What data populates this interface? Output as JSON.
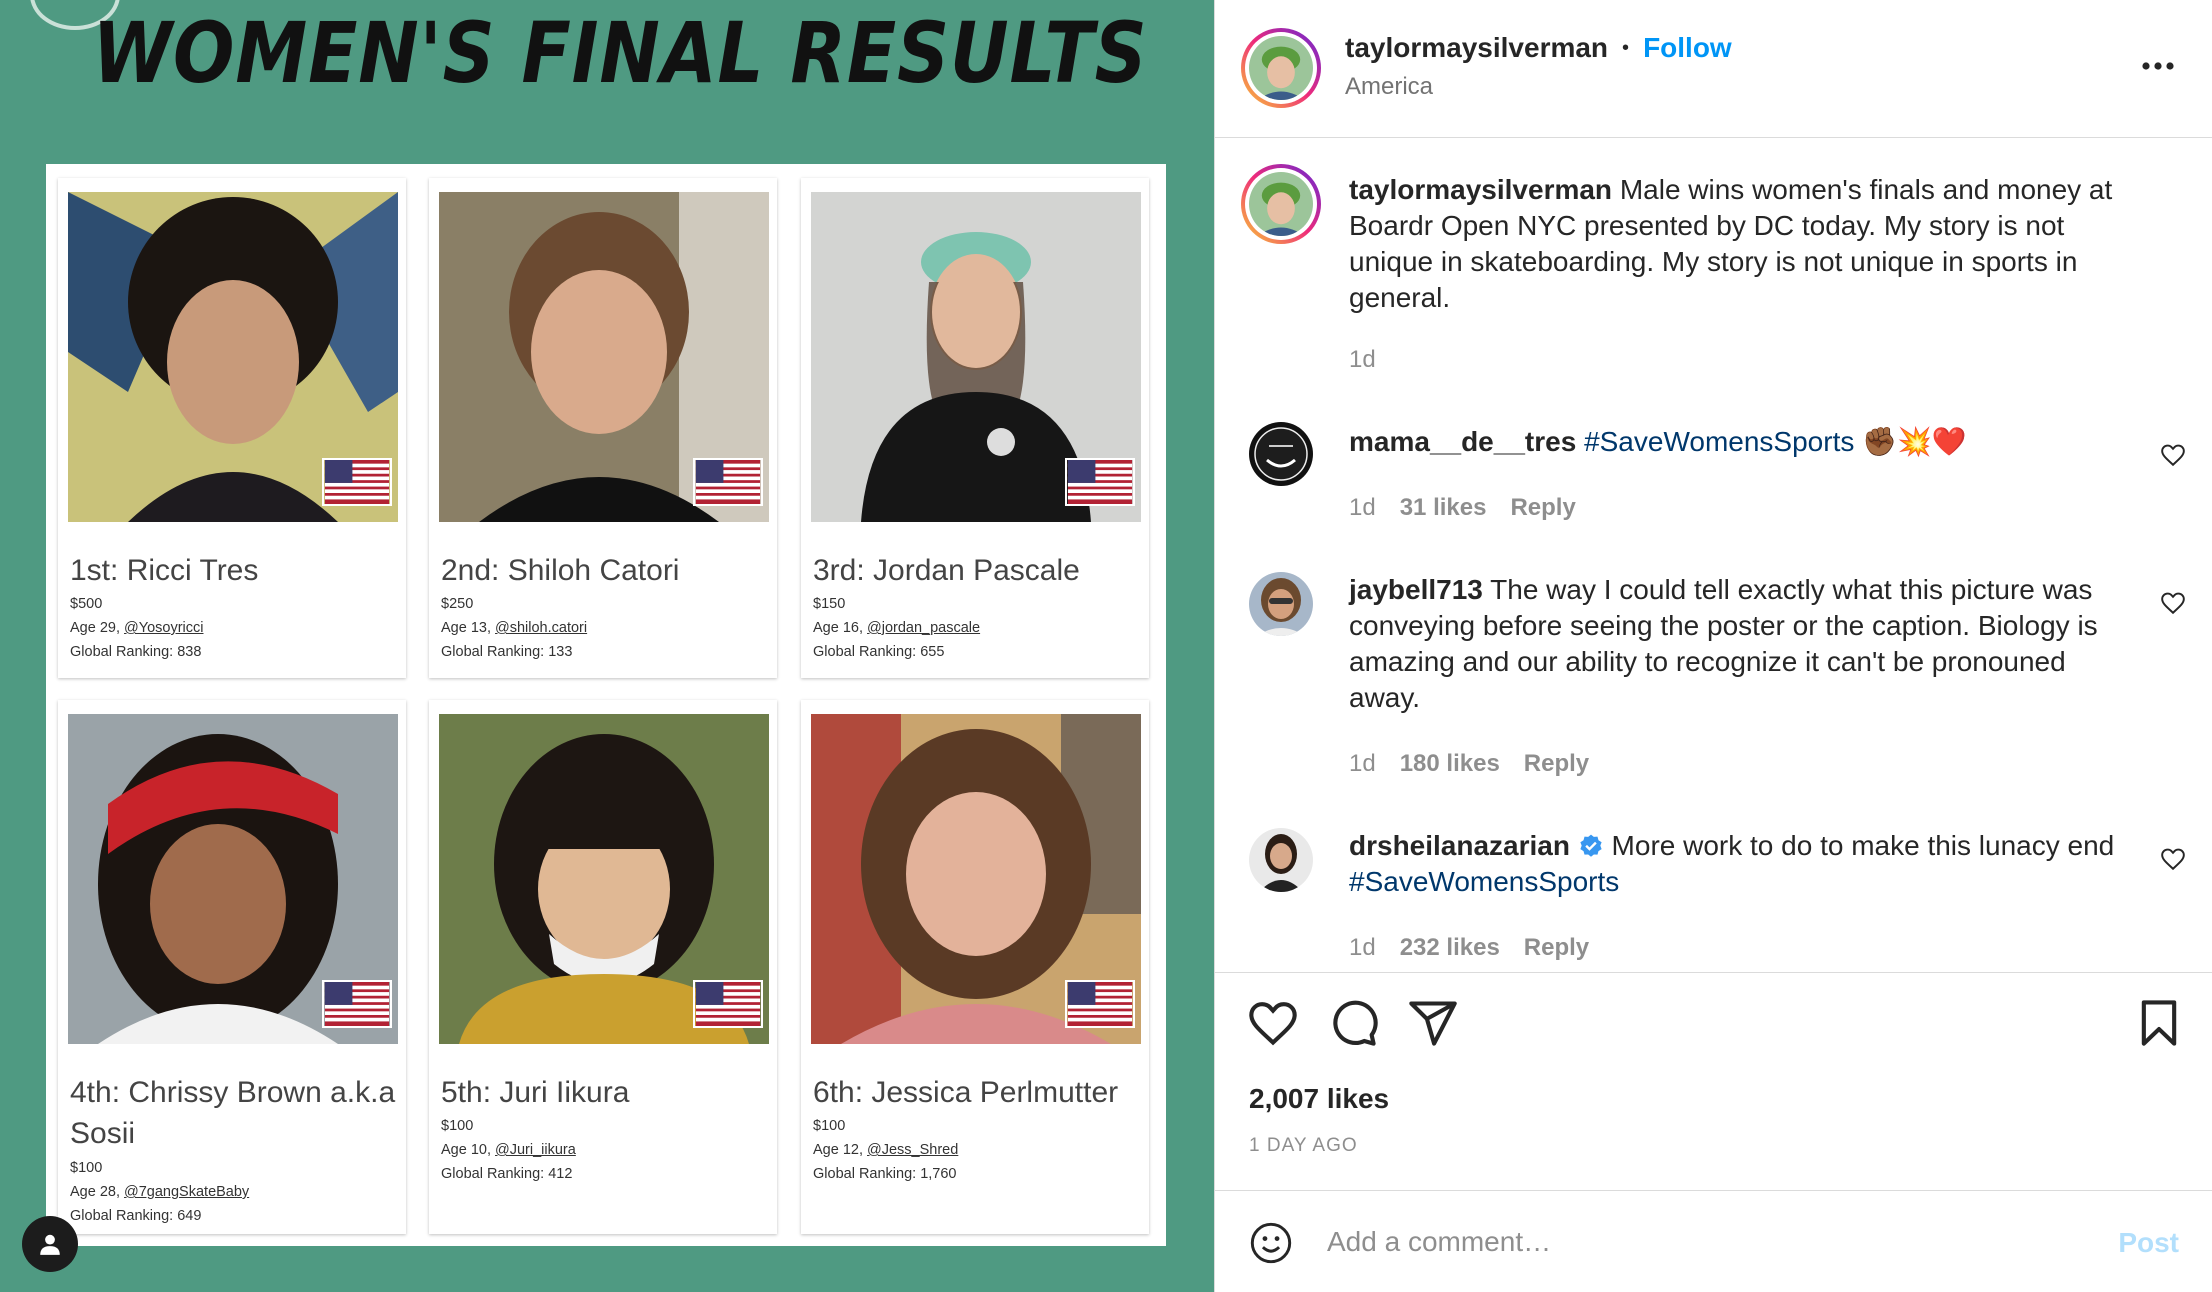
{
  "poster": {
    "title": "WOMEN'S FINAL RESULTS",
    "competitors": [
      {
        "place": "1st: Ricci Tres",
        "prize": "$500",
        "age_prefix": "Age 29, ",
        "handle": "@Yosoyricci",
        "ranking": "Global Ranking: 838"
      },
      {
        "place": "2nd: Shiloh Catori",
        "prize": "$250",
        "age_prefix": "Age 13, ",
        "handle": "@shiloh.catori",
        "ranking": "Global Ranking: 133"
      },
      {
        "place": "3rd: Jordan Pascale",
        "prize": "$150",
        "age_prefix": "Age 16, ",
        "handle": "@jordan_pascale",
        "ranking": "Global Ranking: 655"
      },
      {
        "place": "4th: Chrissy Brown a.k.a Sosii",
        "prize": "$100",
        "age_prefix": "Age 28, ",
        "handle": "@7gangSkateBaby",
        "ranking": "Global Ranking: 649"
      },
      {
        "place": "5th: Juri Iikura",
        "prize": "$100",
        "age_prefix": "Age 10, ",
        "handle": "@Juri_iikura",
        "ranking": "Global Ranking: 412"
      },
      {
        "place": "6th: Jessica Perlmutter",
        "prize": "$100",
        "age_prefix": "Age 12, ",
        "handle": "@Jess_Shred",
        "ranking": "Global Ranking: 1,760"
      }
    ]
  },
  "header": {
    "username": "taylormaysilverman",
    "dot": "•",
    "follow_label": "Follow",
    "location": "America",
    "more_icon": "more-horizontal-icon"
  },
  "caption": {
    "username": "taylormaysilverman",
    "text": " Male wins women's finals and money at Boardr Open NYC presented by DC today. My story is not unique in skateboarding. My story is not unique in sports in general.",
    "time": "1d"
  },
  "comments": [
    {
      "username": "mama__de__tres",
      "pre": " ",
      "tag": "#SaveWomensSports",
      "post": " ✊🏾💥❤️",
      "time": "1d",
      "likes": "31 likes",
      "reply": "Reply"
    },
    {
      "username": "jaybell713",
      "pre": " The way I could tell exactly what this picture was conveying before seeing the poster or the caption. Biology is amazing and our ability to recognize it can't be pronouned away.",
      "tag": "",
      "post": "",
      "time": "1d",
      "likes": "180 likes",
      "reply": "Reply"
    },
    {
      "username": "drsheilanazarian",
      "pre": " More work to do to make this lunacy end ",
      "tag": "#SaveWomensSports",
      "post": "",
      "time": "1d",
      "likes": "232 likes",
      "reply": "Reply",
      "verified": true
    }
  ],
  "actions": {
    "likes": "2,007 likes",
    "date": "1 DAY AGO"
  },
  "composer": {
    "placeholder": "Add a comment…",
    "post_label": "Post"
  },
  "colors": {
    "accent": "#0095f6",
    "poster_bg": "#4f9a82",
    "hashtag": "#00376b"
  }
}
